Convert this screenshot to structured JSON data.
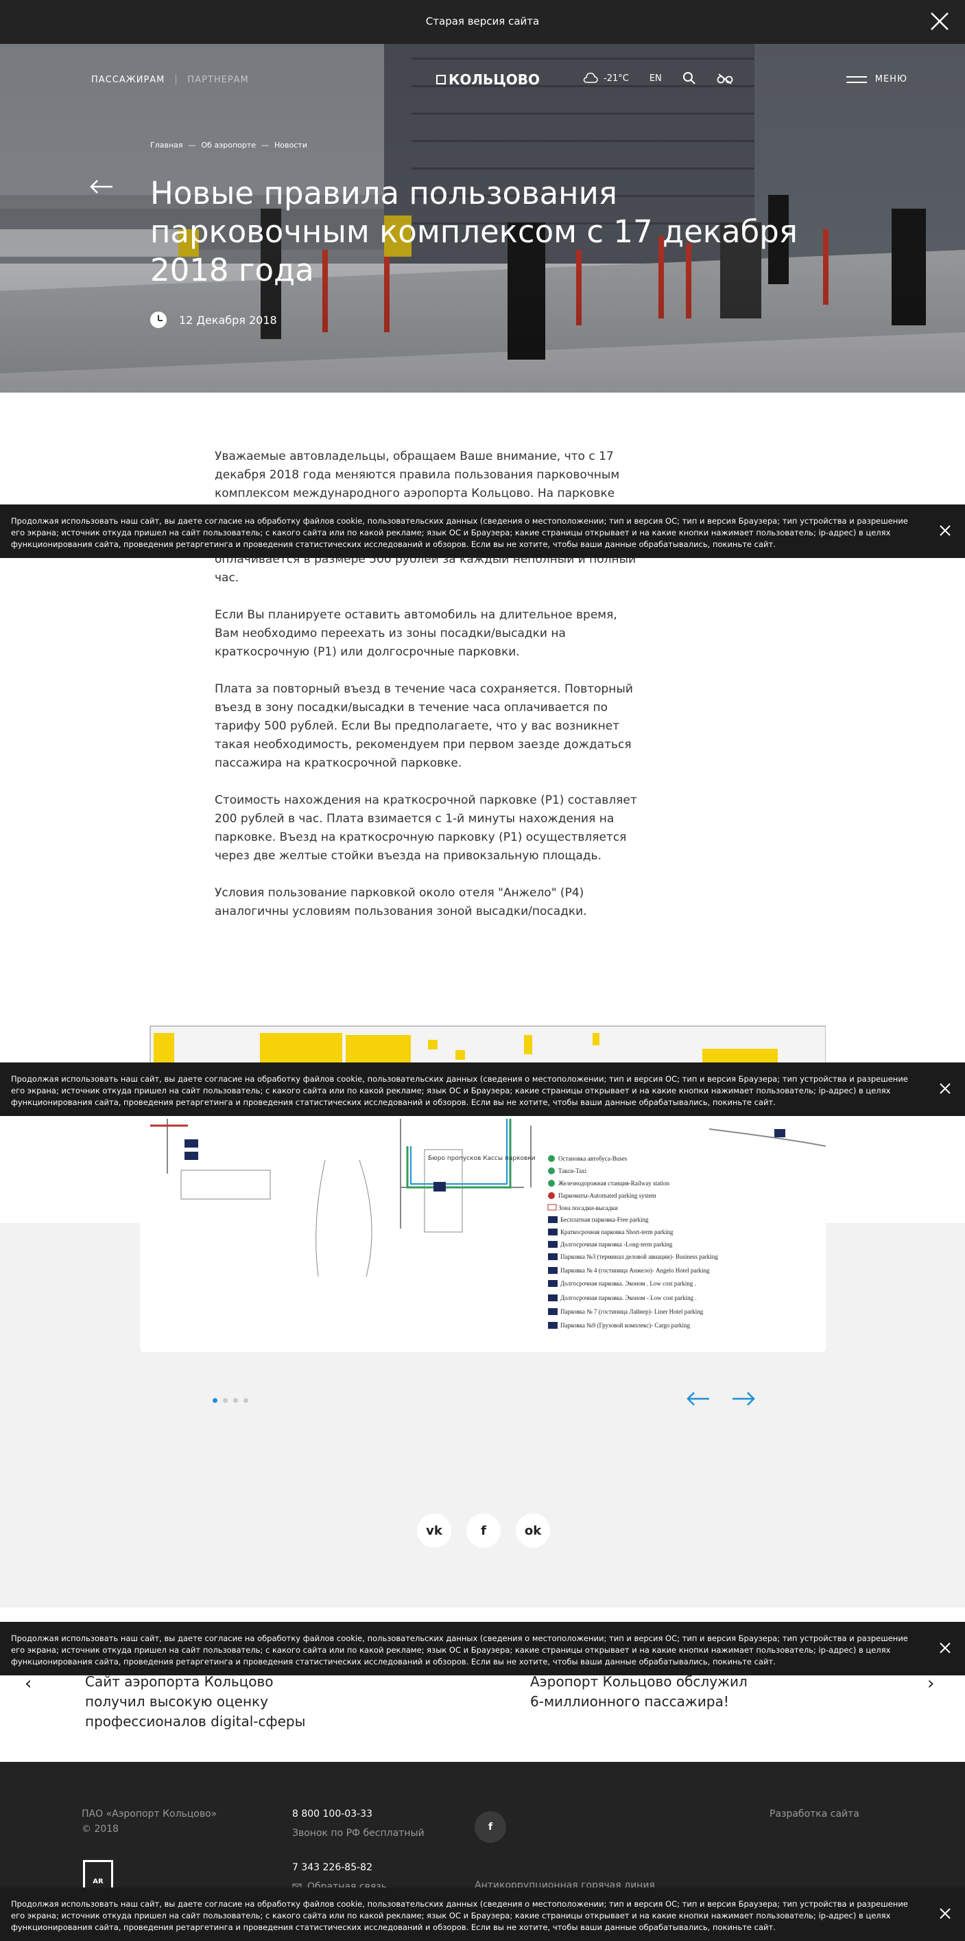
{
  "topbar": {
    "label": "Старая версия сайта"
  },
  "nav": {
    "passengers": "ПАССАЖИРАМ",
    "partners": "ПАРТНЕРАМ",
    "logo": "КОЛЬЦОВО",
    "weather": "-21°C",
    "lang": "EN",
    "menu": "МЕНЮ"
  },
  "breadcrumb": [
    "Главная",
    "—",
    "Об аэропорте",
    "—",
    "Новости"
  ],
  "hero": {
    "title": "Новые правила пользования парковочным комплексом с 17 декабря 2018 года",
    "date": "12 Декабря 2018"
  },
  "article": {
    "paragraphs": [
      "Уважаемые автовладельцы, обращаем Ваше внимание, что с 17 декабря 2018 года меняются правила пользования парковочным комплексом  международного аэропорта Кольцово. На парковке",
      "зоне  предусмотрен бесплатный 15-минутный период. Нахождение автомобиля в зоне посадки/высадки больше 15 минут оплачивается в размере 500 рублей за каждый неполный и полный час.",
      "Если Вы планируете оставить автомобиль на длительное  время, Вам необходимо переехать из зоны посадки/высадки на краткосрочную (Р1) или долгосрочные парковки.",
      "Плата за повторный въезд в течение часа сохраняется. Повторный въезд в зону посадки/высадки в течение часа оплачивается по тарифу 500 рублей. Если Вы предполагаете, что у вас возникнет такая необходимость, рекомендуем при первом заезде дождаться пассажира на краткосрочной парковке.",
      "Стоимость нахождения на краткосрочной парковке (Р1) составляет 200 рублей в час. Плата взимается с 1-й минуты нахождения на парковке. Въезд на краткосрочную парковку (Р1) осуществляется через две желтые стойки въезда на привокзальную площадь.",
      "Условия пользование парковкой около отеля \"Анжело\" (Р4) аналогичны условиям пользования зоной высадки/посадки."
    ]
  },
  "map": {
    "office_label": "Бюро пропусков Кассы парковки",
    "legend": [
      "Остановка автобуса-Buses",
      "Такси-Taxi",
      "Железнодорожная станция-Railway station",
      "Паркоматы-Automated parking system",
      "Зона посадки-высадки",
      "Бесплатная парковка-Free parking",
      "Краткосрочная парковка  Short-term parking",
      "Долгосрочная парковка -Long-term parking",
      "Парковка №3 (терминал деловой авиации)- Business parking",
      "Парковка  № 4 (гостиница Анжело)- Angelo Hotel parking",
      "Долгосрочная парковка. Эконом  .  Low cost parking .",
      "Долгосрочная парковка. Эконом  -  Low cost parking .",
      "Парковка  № 7 (гостиница Лайнер)-  Liner Hotel parking",
      "Парковка №9 (Грузовой комплекс)- Cargo parking"
    ]
  },
  "social": [
    "vk",
    "f",
    "ok"
  ],
  "related": {
    "left": "Сайт аэропорта Кольцово получил высокую оценку профессионалов digital-сферы",
    "right": "Аэропорт Кольцово обслужил 6-миллионного пассажира!"
  },
  "footer": {
    "company": "ПАО «Аэропорт Кольцово»",
    "year": "© 2018",
    "phone1": "8 800 100-03-33",
    "phone1_note": "Звонок по РФ бесплатный",
    "phone2": "7 343 226-85-82",
    "feedback": "Обратная связь",
    "dev": "Разработка сайта",
    "anticorruption": "Антикоррупционная горячая линия",
    "ar": "AR"
  },
  "cookie": {
    "text": "Продолжая использовать наш сайт, вы даете согласие на обработку файлов cookie, пользовательских данных (сведения о местоположении; тип и версия ОС; тип и версия Браузера; тип устройства и разрешение его экрана; источник откуда пришел на сайт пользователь; с какого сайта или по какой рекламе; язык ОС и Браузера; какие страницы открывает и на какие кнопки нажимает пользователь; ip-адрес) в целях функционирования сайта, проведения ретаргетинга и проведения статистических исследований и обзоров. Если вы не хотите, чтобы ваши данные обрабатывались, покиньте сайт."
  },
  "colors": {
    "accent": "#1f8fd6",
    "dark": "#232323",
    "yellow": "#f5d20a"
  }
}
